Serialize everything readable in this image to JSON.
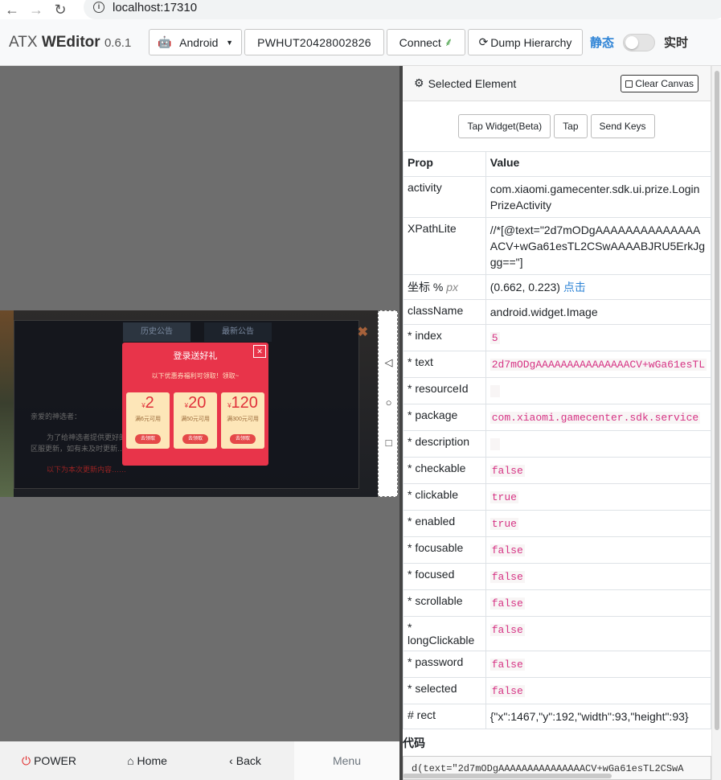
{
  "browser": {
    "url": "localhost:17310"
  },
  "app": {
    "name_prefix": "ATX",
    "name_bold": "WEditor",
    "version": "0.6.1"
  },
  "toolbar": {
    "platform": "Android",
    "serial": "PWHUT20428002826",
    "connect": "Connect",
    "dump": "Dump Hierarchy",
    "static_label": "静态",
    "realtime_label": "实时"
  },
  "device": {
    "notice_tabs": [
      "历史公告",
      "最新公告"
    ],
    "notice_lines": [
      "亲爱的神选者：",
      "为了给神选者提供更好的游戏体验，将于1月15日10:00对全区",
      "区服更新，如有未及时更新……",
      "以下为本次更新内容……"
    ],
    "gift_title": "登录送好礼",
    "gift_sub": "以下优惠券福利可领取！领取~",
    "coupons": [
      {
        "amount": "2",
        "desc": "满6元可用",
        "btn": "去领取"
      },
      {
        "amount": "20",
        "desc": "满50元可用",
        "btn": "去领取"
      },
      {
        "amount": "120",
        "desc": "满300元可用",
        "btn": "去领取"
      }
    ],
    "nav_buttons": [
      "◁",
      "○",
      "□"
    ]
  },
  "bottom": {
    "power": "POWER",
    "home": "Home",
    "back": "Back",
    "menu": "Menu"
  },
  "inspector": {
    "header": "Selected Element",
    "clear": "Clear Canvas",
    "actions": [
      "Tap Widget(Beta)",
      "Tap",
      "Send Keys"
    ],
    "col_prop": "Prop",
    "col_value": "Value",
    "activity_key": "activity",
    "activity": "com.xiaomi.gamecenter.sdk.ui.prize.LoginPrizeActivity",
    "xpath_key": "XPathLite",
    "xpath": "//*[@text=\"2d7mODgAAAAAAAAAAAAAAACV+wGa61esTL2CSwAAAABJRU5ErkJggg==\"]",
    "coord_key": "坐标 %",
    "coord_unit": "px",
    "coord_value": "(0.662, 0.223)",
    "coord_link": "点击",
    "classname_key": "className",
    "classname": "android.widget.Image",
    "rows": [
      {
        "k": "* index",
        "v": "5"
      },
      {
        "k": "* text",
        "v": "2d7mODgAAAAAAAAAAAAAAACV+wGa61esTL"
      },
      {
        "k": "* resourceId",
        "v": ""
      },
      {
        "k": "* package",
        "v": "com.xiaomi.gamecenter.sdk.service"
      },
      {
        "k": "* description",
        "v": ""
      },
      {
        "k": "* checkable",
        "v": "false"
      },
      {
        "k": "* clickable",
        "v": "true"
      },
      {
        "k": "* enabled",
        "v": "true"
      },
      {
        "k": "* focusable",
        "v": "false"
      },
      {
        "k": "* focused",
        "v": "false"
      },
      {
        "k": "* scrollable",
        "v": "false"
      },
      {
        "k": "* longClickable",
        "v": "false"
      },
      {
        "k": "* password",
        "v": "false"
      },
      {
        "k": "* selected",
        "v": "false"
      }
    ],
    "rect_key": "# rect",
    "rect": "{\"x\":1467,\"y\":192,\"width\":93,\"height\":93}",
    "code_title": "代码",
    "code": "d(text=\"2d7mODgAAAAAAAAAAAAAAACV+wGa61esTL2CSwA"
  },
  "colors": {
    "accent": "#2f84d6",
    "power": "#e02424",
    "gift": "#e8344a"
  }
}
